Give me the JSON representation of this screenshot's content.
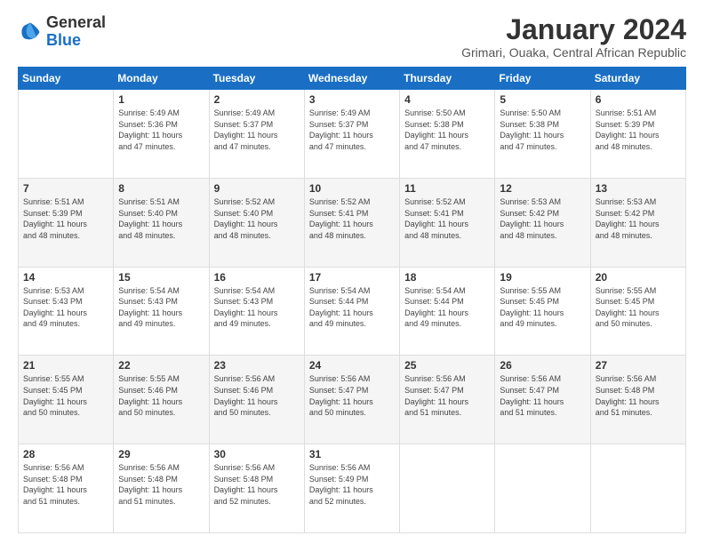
{
  "logo": {
    "general": "General",
    "blue": "Blue"
  },
  "header": {
    "month_year": "January 2024",
    "location": "Grimari, Ouaka, Central African Republic"
  },
  "weekdays": [
    "Sunday",
    "Monday",
    "Tuesday",
    "Wednesday",
    "Thursday",
    "Friday",
    "Saturday"
  ],
  "weeks": [
    [
      {
        "day": "",
        "info": ""
      },
      {
        "day": "1",
        "info": "Sunrise: 5:49 AM\nSunset: 5:36 PM\nDaylight: 11 hours\nand 47 minutes."
      },
      {
        "day": "2",
        "info": "Sunrise: 5:49 AM\nSunset: 5:37 PM\nDaylight: 11 hours\nand 47 minutes."
      },
      {
        "day": "3",
        "info": "Sunrise: 5:49 AM\nSunset: 5:37 PM\nDaylight: 11 hours\nand 47 minutes."
      },
      {
        "day": "4",
        "info": "Sunrise: 5:50 AM\nSunset: 5:38 PM\nDaylight: 11 hours\nand 47 minutes."
      },
      {
        "day": "5",
        "info": "Sunrise: 5:50 AM\nSunset: 5:38 PM\nDaylight: 11 hours\nand 47 minutes."
      },
      {
        "day": "6",
        "info": "Sunrise: 5:51 AM\nSunset: 5:39 PM\nDaylight: 11 hours\nand 48 minutes."
      }
    ],
    [
      {
        "day": "7",
        "info": "Sunrise: 5:51 AM\nSunset: 5:39 PM\nDaylight: 11 hours\nand 48 minutes."
      },
      {
        "day": "8",
        "info": "Sunrise: 5:51 AM\nSunset: 5:40 PM\nDaylight: 11 hours\nand 48 minutes."
      },
      {
        "day": "9",
        "info": "Sunrise: 5:52 AM\nSunset: 5:40 PM\nDaylight: 11 hours\nand 48 minutes."
      },
      {
        "day": "10",
        "info": "Sunrise: 5:52 AM\nSunset: 5:41 PM\nDaylight: 11 hours\nand 48 minutes."
      },
      {
        "day": "11",
        "info": "Sunrise: 5:52 AM\nSunset: 5:41 PM\nDaylight: 11 hours\nand 48 minutes."
      },
      {
        "day": "12",
        "info": "Sunrise: 5:53 AM\nSunset: 5:42 PM\nDaylight: 11 hours\nand 48 minutes."
      },
      {
        "day": "13",
        "info": "Sunrise: 5:53 AM\nSunset: 5:42 PM\nDaylight: 11 hours\nand 48 minutes."
      }
    ],
    [
      {
        "day": "14",
        "info": "Sunrise: 5:53 AM\nSunset: 5:43 PM\nDaylight: 11 hours\nand 49 minutes."
      },
      {
        "day": "15",
        "info": "Sunrise: 5:54 AM\nSunset: 5:43 PM\nDaylight: 11 hours\nand 49 minutes."
      },
      {
        "day": "16",
        "info": "Sunrise: 5:54 AM\nSunset: 5:43 PM\nDaylight: 11 hours\nand 49 minutes."
      },
      {
        "day": "17",
        "info": "Sunrise: 5:54 AM\nSunset: 5:44 PM\nDaylight: 11 hours\nand 49 minutes."
      },
      {
        "day": "18",
        "info": "Sunrise: 5:54 AM\nSunset: 5:44 PM\nDaylight: 11 hours\nand 49 minutes."
      },
      {
        "day": "19",
        "info": "Sunrise: 5:55 AM\nSunset: 5:45 PM\nDaylight: 11 hours\nand 49 minutes."
      },
      {
        "day": "20",
        "info": "Sunrise: 5:55 AM\nSunset: 5:45 PM\nDaylight: 11 hours\nand 50 minutes."
      }
    ],
    [
      {
        "day": "21",
        "info": "Sunrise: 5:55 AM\nSunset: 5:45 PM\nDaylight: 11 hours\nand 50 minutes."
      },
      {
        "day": "22",
        "info": "Sunrise: 5:55 AM\nSunset: 5:46 PM\nDaylight: 11 hours\nand 50 minutes."
      },
      {
        "day": "23",
        "info": "Sunrise: 5:56 AM\nSunset: 5:46 PM\nDaylight: 11 hours\nand 50 minutes."
      },
      {
        "day": "24",
        "info": "Sunrise: 5:56 AM\nSunset: 5:47 PM\nDaylight: 11 hours\nand 50 minutes."
      },
      {
        "day": "25",
        "info": "Sunrise: 5:56 AM\nSunset: 5:47 PM\nDaylight: 11 hours\nand 51 minutes."
      },
      {
        "day": "26",
        "info": "Sunrise: 5:56 AM\nSunset: 5:47 PM\nDaylight: 11 hours\nand 51 minutes."
      },
      {
        "day": "27",
        "info": "Sunrise: 5:56 AM\nSunset: 5:48 PM\nDaylight: 11 hours\nand 51 minutes."
      }
    ],
    [
      {
        "day": "28",
        "info": "Sunrise: 5:56 AM\nSunset: 5:48 PM\nDaylight: 11 hours\nand 51 minutes."
      },
      {
        "day": "29",
        "info": "Sunrise: 5:56 AM\nSunset: 5:48 PM\nDaylight: 11 hours\nand 51 minutes."
      },
      {
        "day": "30",
        "info": "Sunrise: 5:56 AM\nSunset: 5:48 PM\nDaylight: 11 hours\nand 52 minutes."
      },
      {
        "day": "31",
        "info": "Sunrise: 5:56 AM\nSunset: 5:49 PM\nDaylight: 11 hours\nand 52 minutes."
      },
      {
        "day": "",
        "info": ""
      },
      {
        "day": "",
        "info": ""
      },
      {
        "day": "",
        "info": ""
      }
    ]
  ]
}
